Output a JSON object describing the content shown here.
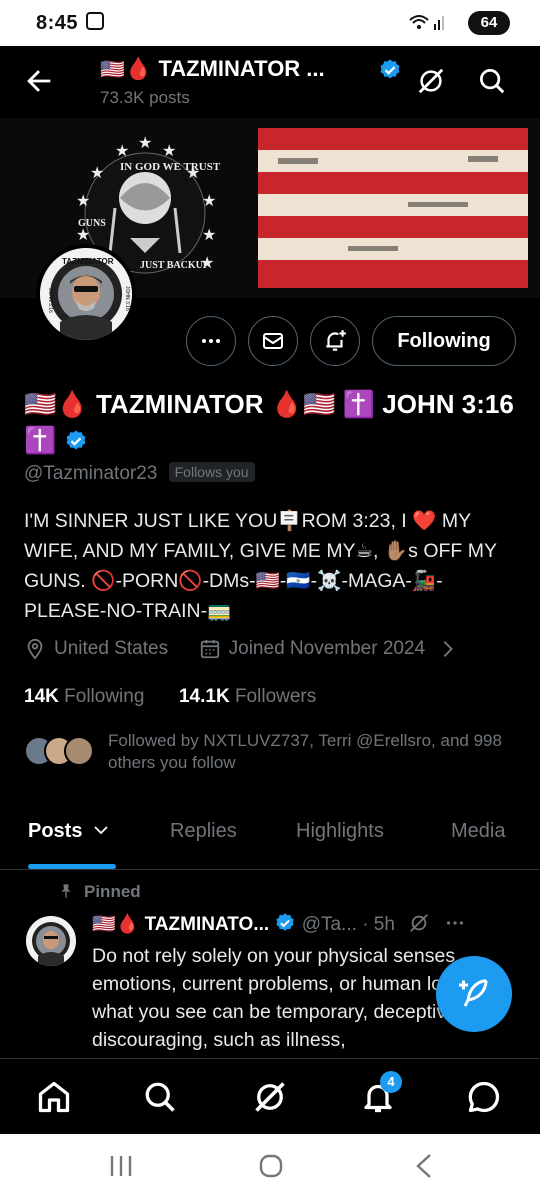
{
  "status_bar": {
    "time": "8:45",
    "battery": "64"
  },
  "header": {
    "flag_emoji": "🇺🇸",
    "drop_emoji": "🩸",
    "title": "TAZMINATOR ...",
    "posts_count": "73.3K posts"
  },
  "banner": {
    "emblem_text_top": "IN GOD WE TRUST",
    "emblem_text_left": "GUNS",
    "emblem_text_right": "JUST BACKUP"
  },
  "avatar": {
    "ring_text_top": "TAZMINATOR",
    "ring_text_left": "JOHN 3:16",
    "ring_text_right": "JOHN 3:16"
  },
  "actions": {
    "follow_label": "Following"
  },
  "profile": {
    "name": "🇺🇸🩸 TAZMINATOR 🩸🇺🇸 ✝️ JOHN 3:16 ✝️",
    "handle": "@Tazminator23",
    "follows_you": "Follows you",
    "bio": "I'M SINNER JUST LIKE YOU🪧ROM 3:23, I ❤️ MY WIFE, AND MY FAMILY, GIVE ME MY☕, ✋🏽s OFF MY GUNS. 🚫-PORN🚫-DMs-🇺🇸-🇸🇻-☠️-MAGA-🚂-PLEASE-NO-TRAIN-🚃",
    "location": "United States",
    "joined": "Joined November 2024",
    "following_count": "14K",
    "following_label": "Following",
    "followers_count": "14.1K",
    "followers_label": "Followers",
    "followed_by": "Followed by NXTLUVZ737, Terri @Erellsro, and 998 others you follow"
  },
  "tabs": [
    "Posts",
    "Replies",
    "Highlights",
    "Media"
  ],
  "pinned_post": {
    "pinned_label": "Pinned",
    "author": "🇺🇸🩸 TAZMINATO...",
    "handle": "@Ta...",
    "time": "· 5h",
    "text": "Do not rely solely on your physical senses, emotions, current problems, or human logic, for what you see can be temporary, deceptive, or discouraging, such as illness,"
  },
  "bottom_nav": {
    "notifications_badge": "4"
  },
  "colors": {
    "accent": "#1d9bf0",
    "background": "#000000",
    "muted": "#71767b",
    "border": "#536471"
  },
  "icons": [
    "back-arrow-icon",
    "verified-icon",
    "grok-icon",
    "search-icon",
    "more-icon",
    "mail-icon",
    "bell-plus-icon",
    "location-icon",
    "calendar-icon",
    "chevron-right-icon",
    "chevron-down-icon",
    "pin-icon",
    "feather-plus-icon",
    "home-icon",
    "bell-icon",
    "chat-icon"
  ]
}
